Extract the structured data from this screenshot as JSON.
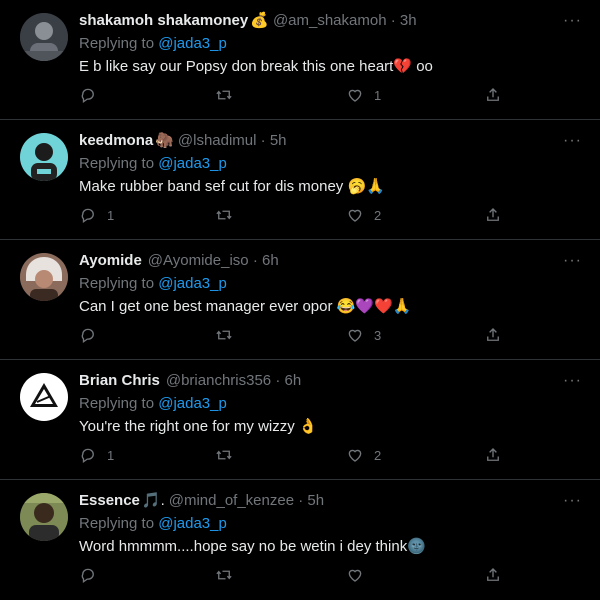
{
  "tweets": [
    {
      "name": "shakamoh shakamoney",
      "badge": "💰",
      "handle": "@am_shakamoh",
      "sep": "·",
      "time": "3h",
      "replying_prefix": "Replying to ",
      "replying_to": "@jada3_p",
      "text": "E b like say our Popsy don break this one heart💔 oo",
      "reply_count": "",
      "retweet_count": "",
      "like_count": "1"
    },
    {
      "name": "keedmona",
      "badge": "🦣",
      "handle": "@lshadimul",
      "sep": "·",
      "time": "5h",
      "replying_prefix": "Replying to ",
      "replying_to": "@jada3_p",
      "text": "Make rubber band sef cut for dis money 🥱🙏",
      "reply_count": "1",
      "retweet_count": "",
      "like_count": "2"
    },
    {
      "name": "Ayomide",
      "badge": "",
      "handle": "@Ayomide_iso",
      "sep": "·",
      "time": "6h",
      "replying_prefix": "Replying to ",
      "replying_to": "@jada3_p",
      "text": "Can I get one best manager ever opor 😂💜❤️🙏",
      "reply_count": "",
      "retweet_count": "",
      "like_count": "3"
    },
    {
      "name": "Brian Chris",
      "badge": "",
      "handle": "@brianchris356",
      "sep": "·",
      "time": "6h",
      "replying_prefix": "Replying to ",
      "replying_to": "@jada3_p",
      "text": "You're the right one for my wizzy 👌",
      "reply_count": "1",
      "retweet_count": "",
      "like_count": "2"
    },
    {
      "name": "Essence",
      "badge": "🎵.",
      "handle": "@mind_of_kenzee",
      "sep": "·",
      "time": "5h",
      "replying_prefix": "Replying to ",
      "replying_to": "@jada3_p",
      "text": "Word hmmmm....hope say no be wetin i dey think🌚",
      "reply_count": "",
      "retweet_count": "",
      "like_count": ""
    }
  ],
  "more_label": "···",
  "colors": {
    "background": "#000000",
    "text": "#e7e9ea",
    "muted": "#71767b",
    "accent": "#1d9bf0",
    "divider": "#2f3336"
  }
}
